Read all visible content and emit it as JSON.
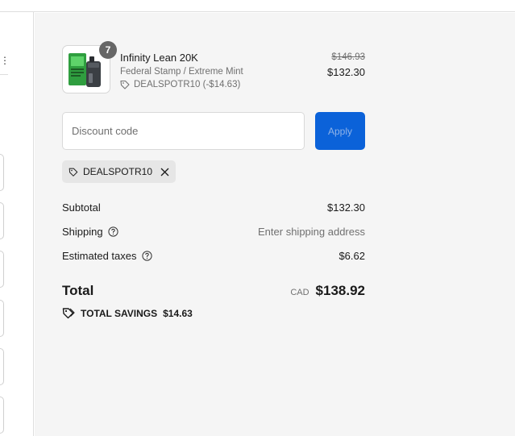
{
  "left_panel": {
    "menu_glyph": "⋮"
  },
  "product": {
    "quantity": "7",
    "name": "Infinity Lean 20K",
    "variant": "Federal Stamp / Extreme Mint",
    "discount_line": "DEALSPOTR10 (-$14.63)",
    "original_price": "$146.93",
    "price": "$132.30",
    "thumbnail_icon": "vape-device-image"
  },
  "discount": {
    "placeholder": "Discount code",
    "value": "",
    "apply_label": "Apply",
    "applied_code": "DEALSPOTR10"
  },
  "summary": {
    "subtotal_label": "Subtotal",
    "subtotal_value": "$132.30",
    "shipping_label": "Shipping",
    "shipping_value": "Enter shipping address",
    "taxes_label": "Estimated taxes",
    "taxes_value": "$6.62",
    "total_label": "Total",
    "currency": "CAD",
    "total_value": "$138.92",
    "savings_label": "TOTAL SAVINGS",
    "savings_value": "$14.63"
  },
  "colors": {
    "accent": "#0b62d9",
    "panel_bg": "#f5f5f5",
    "muted_text": "#707070",
    "chip_bg": "#e6e6e6"
  },
  "icons": [
    "tag-icon",
    "close-icon",
    "help-circle-icon",
    "savings-tag-icon",
    "kebab-menu-icon"
  ]
}
